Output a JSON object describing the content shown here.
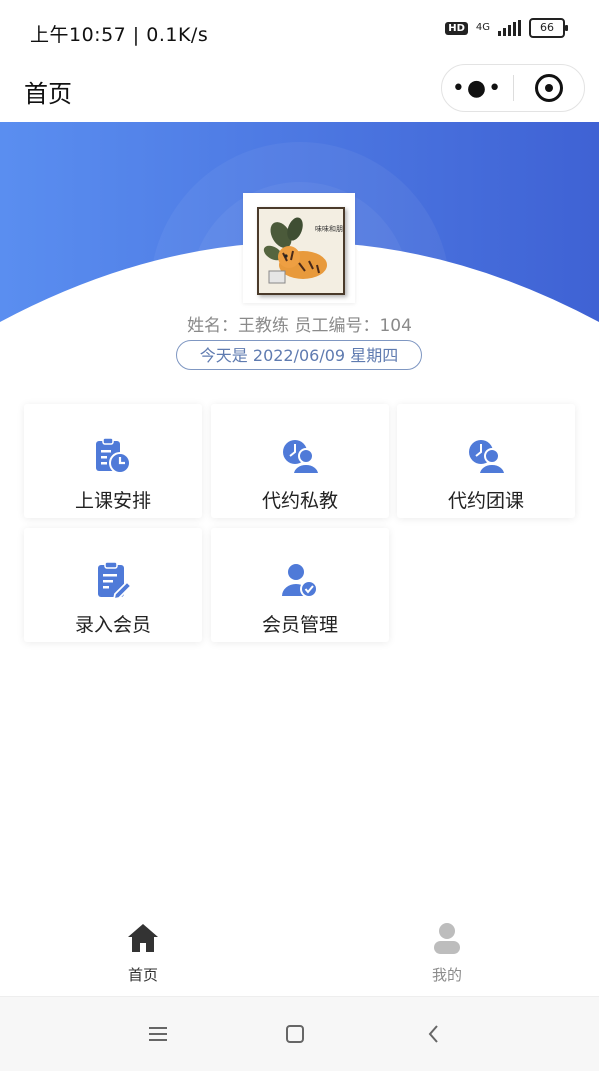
{
  "status_bar": {
    "time_speed": "上午10:57 | 0.1K/s",
    "hd": "HD",
    "network": "4G",
    "battery": "66"
  },
  "nav": {
    "title": "首页",
    "more_icon": "more-dots-icon",
    "close_icon": "capsule-close-icon"
  },
  "profile": {
    "info": "姓名：王教练 员工编号：104",
    "date": "今天是 2022/06/09 星期四",
    "avatar_text": "味味和朋"
  },
  "menu": [
    {
      "label": "上课安排",
      "icon": "schedule-clock-icon"
    },
    {
      "label": "代约私教",
      "icon": "private-coach-booking-icon"
    },
    {
      "label": "代约团课",
      "icon": "group-class-booking-icon"
    },
    {
      "label": "录入会员",
      "icon": "member-entry-icon"
    },
    {
      "label": "会员管理",
      "icon": "member-manage-icon"
    }
  ],
  "tabbar": {
    "home_label": "首页",
    "mine_label": "我的",
    "home_icon": "home-icon",
    "mine_icon": "user-icon"
  },
  "colors": {
    "primary": "#4a74d9",
    "icon": "#4f7ad8",
    "date_border": "#7f97c2"
  }
}
